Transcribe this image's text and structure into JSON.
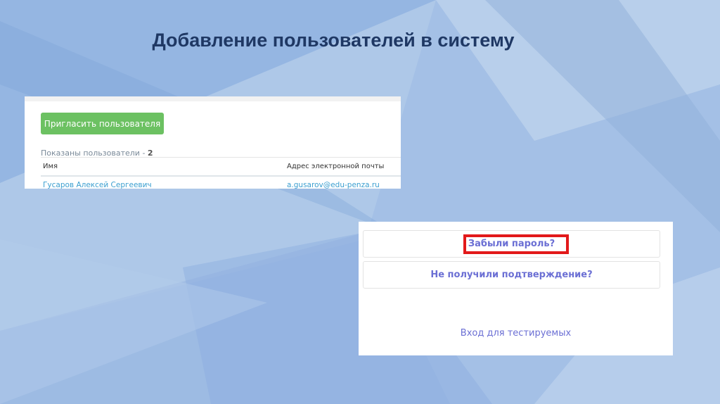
{
  "slide": {
    "title": "Добавление пользователей в систему"
  },
  "users_panel": {
    "invite_button": "Пригласить пользователя",
    "shown_label": "Показаны пользователи - ",
    "shown_count": "2",
    "columns": {
      "name": "Имя",
      "email": "Адрес электронной почты"
    },
    "rows": [
      {
        "name": "Гусаров Алексей Сергеевич",
        "email": "a.gusarov@edu-penza.ru"
      }
    ]
  },
  "login_panel": {
    "forgot_password": "Забыли пароль?",
    "no_confirmation": "Не получили подтверждение?",
    "test_login": "Вход для тестируемых"
  },
  "colors": {
    "title": "#1f3864",
    "invite_button": "#6cc162",
    "link": "#6b6fd4",
    "highlight_frame": "#e2191a"
  }
}
